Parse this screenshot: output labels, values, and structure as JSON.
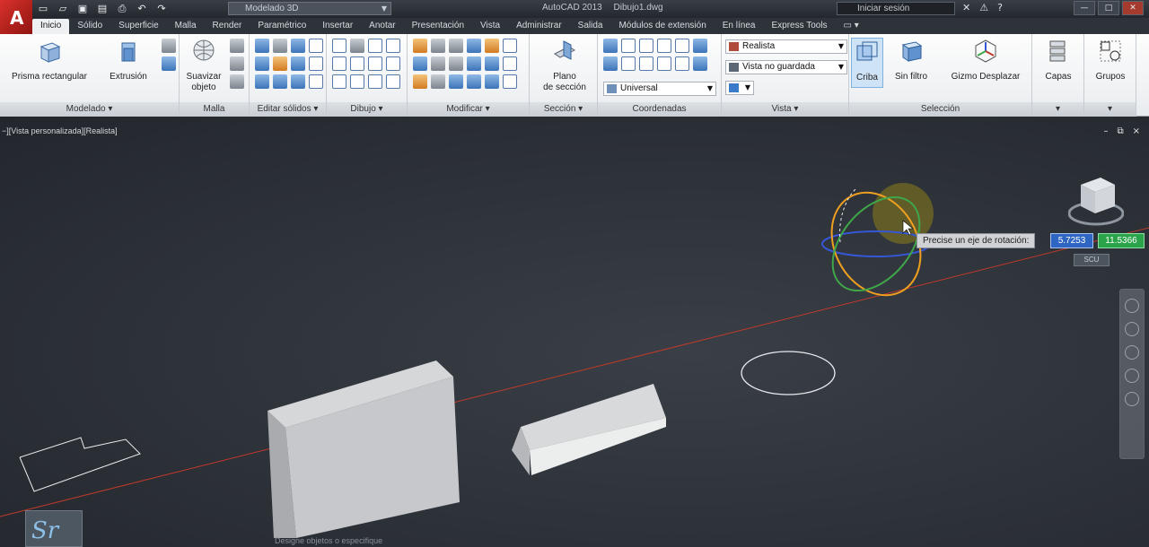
{
  "titlebar": {
    "workspace": "Modelado 3D",
    "app_name": "AutoCAD 2013",
    "file_name": "Dibujo1.dwg",
    "signin_label": "Iniciar sesión",
    "qat_icons": [
      "new-icon",
      "open-icon",
      "save-icon",
      "saveas-icon",
      "plot-icon",
      "undo-icon",
      "redo-icon"
    ]
  },
  "tabs": [
    "Inicio",
    "Sólido",
    "Superficie",
    "Malla",
    "Render",
    "Paramétrico",
    "Insertar",
    "Anotar",
    "Presentación",
    "Vista",
    "Administrar",
    "Salida",
    "Módulos de extensión",
    "En línea",
    "Express Tools"
  ],
  "active_tab": "Inicio",
  "ribbon": {
    "modelado": {
      "title": "Modelado ▾",
      "box_label": "Prisma rectangular",
      "extrude_label": "Extrusión"
    },
    "malla": {
      "title": "Malla",
      "smooth_label_1": "Suavizar",
      "smooth_label_2": "objeto"
    },
    "editar_solidos": {
      "title": "Editar sólidos ▾"
    },
    "dibujo": {
      "title": "Dibujo ▾"
    },
    "modificar": {
      "title": "Modificar ▾"
    },
    "seccion": {
      "title": "Sección ▾",
      "plane_label_1": "Plano",
      "plane_label_2": "de sección"
    },
    "coordenadas": {
      "title": "Coordenadas",
      "ucs_combo": "Universal"
    },
    "vista": {
      "title": "Vista ▾",
      "visual_style": "Realista",
      "view_state": "Vista no guardada"
    },
    "seleccion": {
      "title": "Selección",
      "culling_label": "Criba",
      "filter_label": "Sin filtro",
      "gizmo_label": "Gizmo Desplazar"
    },
    "capas": {
      "label": "Capas"
    },
    "grupos": {
      "label": "Grupos"
    }
  },
  "viewport": {
    "label": "−][Vista personalizada][Realista]",
    "controls": [
      "–",
      "⧉",
      "×"
    ],
    "prompt": "Precise un eje de rotación:",
    "input_1": "5.7253",
    "input_2": "11.5366",
    "wcs_label": "SCU",
    "command_history": "Designe objetos o especifique"
  },
  "colors": {
    "accent_blue": "#2f66c3",
    "input_green": "#2aa34a",
    "axis_red": "#c0392b",
    "gizmo_orange": "#f0a020",
    "gizmo_green": "#3fa64a",
    "gizmo_blue": "#3557d6"
  }
}
